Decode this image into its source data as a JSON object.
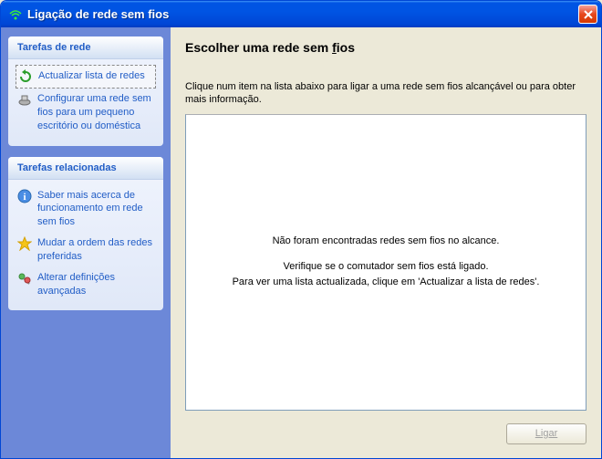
{
  "window": {
    "title": "Ligação de rede sem fios"
  },
  "sidebar": {
    "panels": [
      {
        "header": "Tarefas de rede",
        "items": [
          {
            "label": "Actualizar lista de redes",
            "icon": "refresh-icon"
          },
          {
            "label": "Configurar uma rede sem fios para um pequeno escritório ou doméstica",
            "icon": "setup-icon"
          }
        ]
      },
      {
        "header": "Tarefas relacionadas",
        "items": [
          {
            "label": "Saber mais acerca de funcionamento em rede sem fios",
            "icon": "info-icon"
          },
          {
            "label": "Mudar a ordem das redes preferidas",
            "icon": "star-icon"
          },
          {
            "label": "Alterar definições avançadas",
            "icon": "settings-icon"
          }
        ]
      }
    ]
  },
  "main": {
    "title_prefix": "Escolher uma rede sem ",
    "title_underlined": "f",
    "title_suffix": "ios",
    "instructions": "Clique num item na lista abaixo para ligar a uma rede sem fios alcançável ou para obter mais informação.",
    "empty_line1": "Não foram encontradas redes sem fios no alcance.",
    "empty_line2": "Verifique se o comutador sem fios está ligado.",
    "empty_line3": "Para ver uma lista actualizada, clique em 'Actualizar a lista de redes'.",
    "connect_button": "Ligar"
  }
}
